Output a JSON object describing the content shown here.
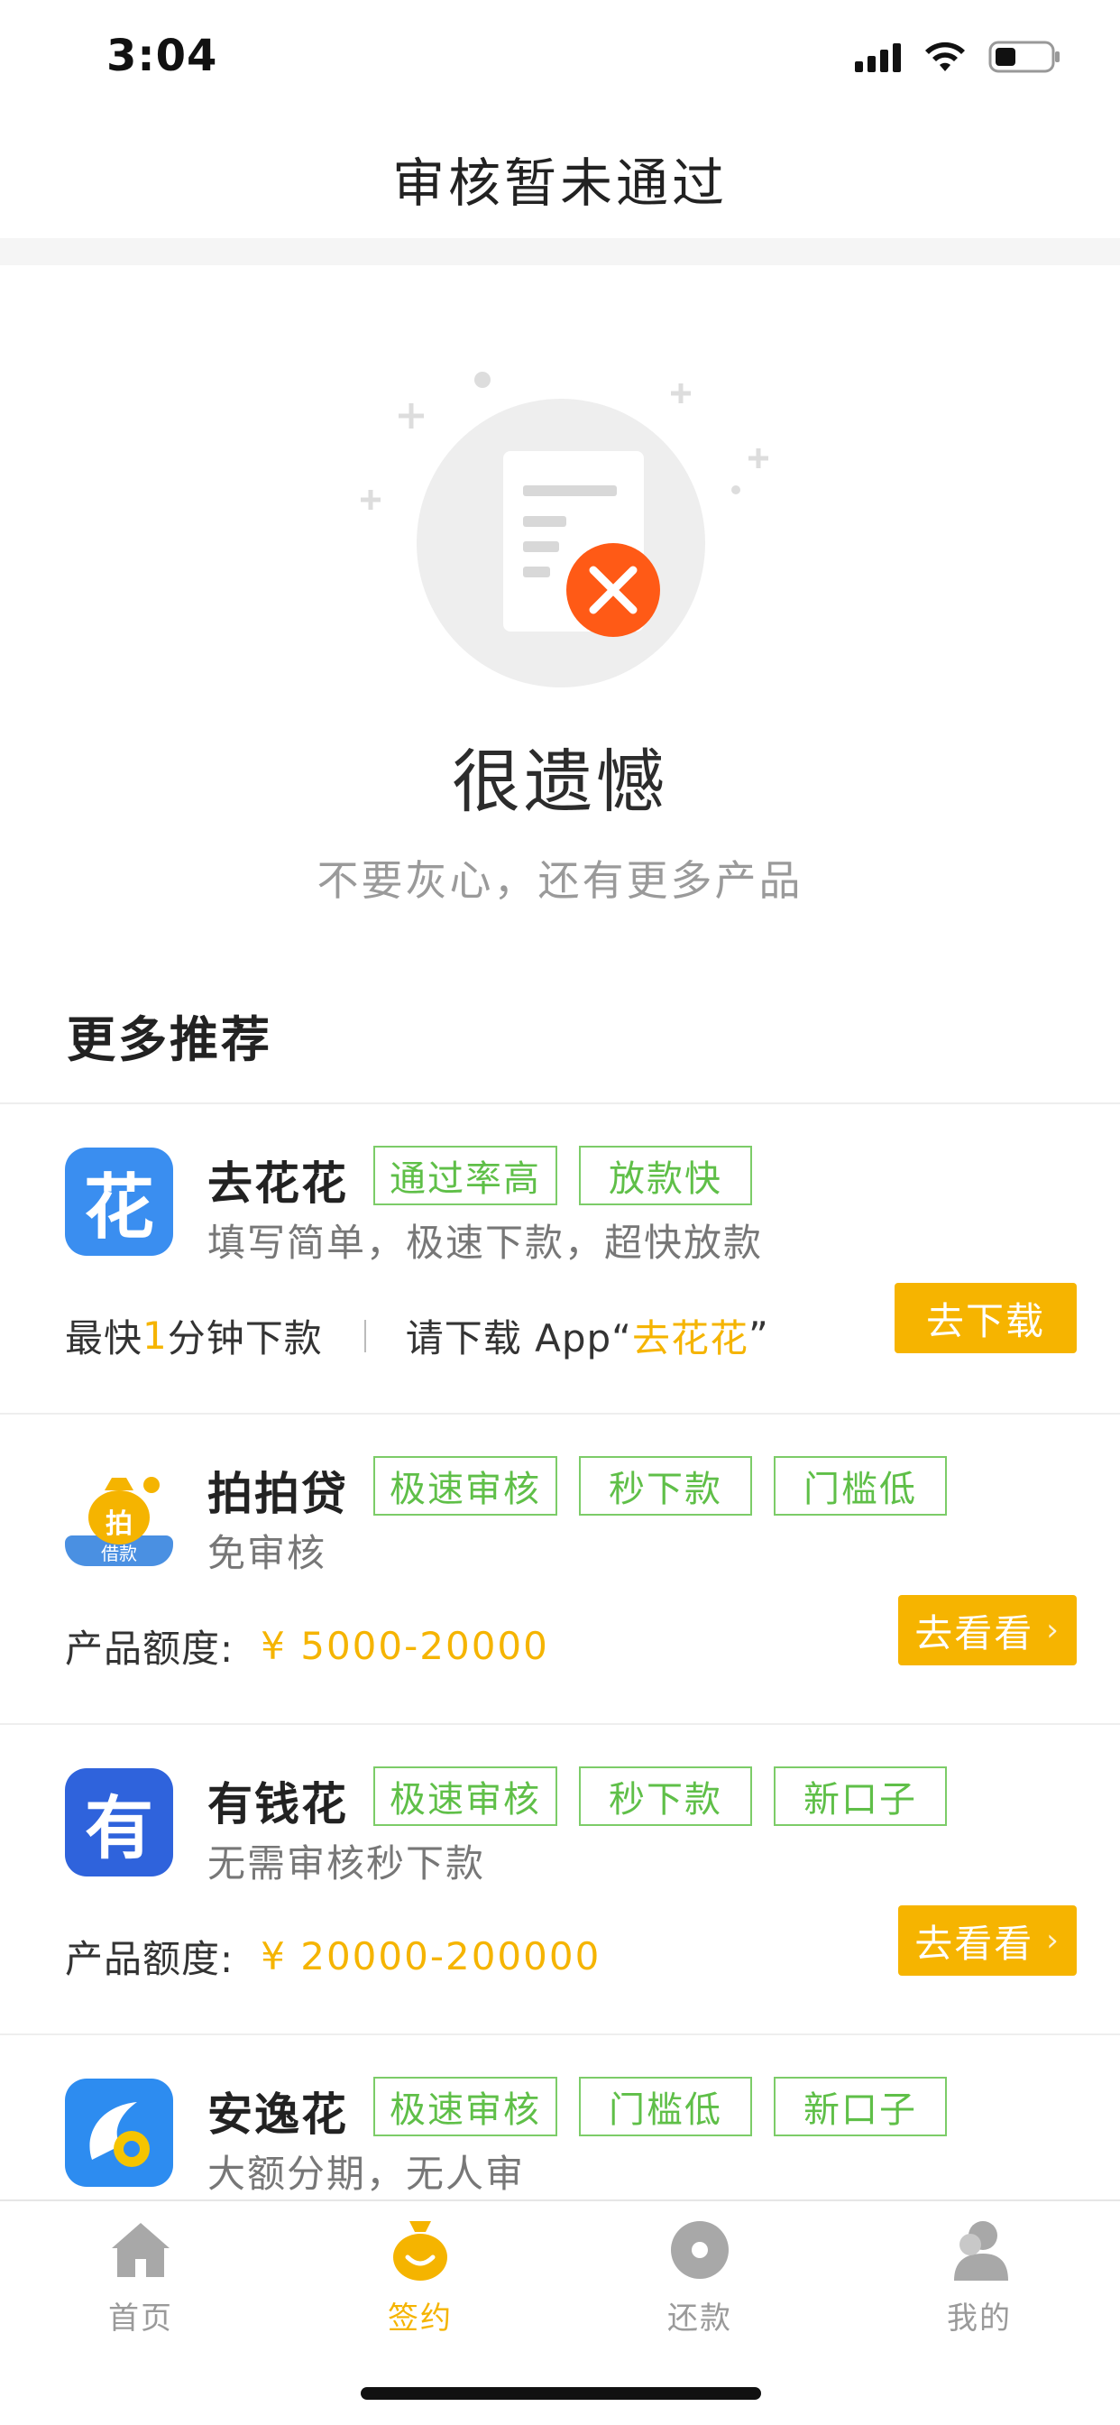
{
  "status_bar": {
    "time": "3:04"
  },
  "nav": {
    "title": "审核暂未通过"
  },
  "result": {
    "title": "很遗憾",
    "subtitle": "不要灰心，还有更多产品"
  },
  "section": {
    "title": "更多推荐"
  },
  "products": [
    {
      "name": "去花花",
      "tags": [
        "通过率高",
        "放款快"
      ],
      "desc": "填写简单，极速下款，超快放款",
      "speed_prefix": "最快",
      "speed_num": "1",
      "speed_suffix": "分钟下款",
      "download_prefix": "请下载 App“",
      "download_app": "去花花",
      "download_suffix": "”",
      "button": "去下载",
      "logo_char": "花",
      "logo_color": "#3a8ef0"
    },
    {
      "name": "拍拍贷",
      "tags": [
        "极速审核",
        "秒下款",
        "门槛低"
      ],
      "desc": "免审核",
      "amount_label": "产品额度:",
      "amount": "¥ 5000-20000",
      "button": "去看看",
      "logo_char": "拍",
      "logo_sub": "借款",
      "logo_color": "#f5b400"
    },
    {
      "name": "有钱花",
      "tags": [
        "极速审核",
        "秒下款",
        "新口子"
      ],
      "desc": "无需审核秒下款",
      "amount_label": "产品额度:",
      "amount": "¥ 20000-200000",
      "button": "去看看",
      "logo_char": "有",
      "logo_color": "#2f63dc"
    },
    {
      "name": "安逸花",
      "tags": [
        "极速审核",
        "门槛低",
        "新口子"
      ],
      "desc": "大额分期，无人审",
      "logo_color": "#2d8cf0"
    }
  ],
  "tabbar": {
    "tabs": [
      {
        "label": "首页",
        "icon": "home-icon"
      },
      {
        "label": "签约",
        "icon": "money-bag-icon"
      },
      {
        "label": "还款",
        "icon": "disc-icon"
      },
      {
        "label": "我的",
        "icon": "user-icon"
      }
    ],
    "active_index": 1
  },
  "colors": {
    "accent": "#f5b400",
    "tag_green": "#5fbf48",
    "error": "#ff5a16"
  }
}
